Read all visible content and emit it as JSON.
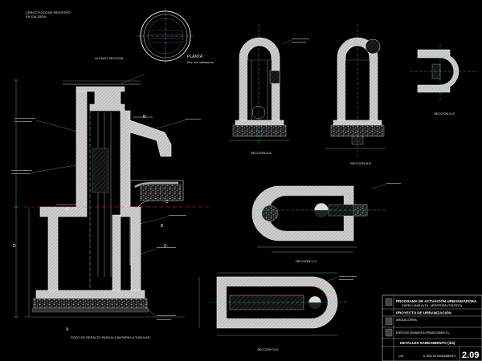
{
  "drawing": {
    "top_note": "CERCO POZO DE REGISTRO\nEN CALZADA",
    "planta_label": "PLANTA",
    "planta_scale": "Esc: en milímetros",
    "alzado_label": "ALZADO SECCIÓN",
    "main_title": "POZO DE RESALTO PARA ALCANTARILLA TUBULAR",
    "section_aa": "SECCIÓN A-A",
    "section_bb": "SECCIÓN B-B",
    "section_cc": "SECCIÓN C-C",
    "section_dd": "SECCIÓN D-D",
    "section_ee": "SECCIÓN E-E",
    "cut_a": "A",
    "cut_b": "B",
    "cut_c": "C",
    "cut_d": "D"
  },
  "title_block": {
    "project_line1": "PROGRAMA DE ACTUACIÓN URBANIZADORA",
    "project_line2": "CAPELLANÍA ALTA - MÉNTRIDA (TOLEDO)",
    "phase": "PROYECTO DE URBANIZACIÓN",
    "architect": "ARQUICORRA",
    "promoter": "EDIFICIOS GRANDES & PROMOCIONES S.L.",
    "sheet_title": "DETALLES SANEAMIENTO (3/4)",
    "sheet_code": "2.09",
    "scale": "1/15",
    "subtitle": "D. RED DE SANEAMIENTO"
  },
  "colors": {
    "background": "#000000",
    "wall_fill": "#c8c8c8",
    "wall_hatch": "#8a8a8a",
    "gravel": "#9a9a9a",
    "line": "#e0e0e0",
    "cyan": "#48d6e6",
    "green": "#6ad06a",
    "red": "#e04848",
    "magenta": "#d060d0"
  }
}
